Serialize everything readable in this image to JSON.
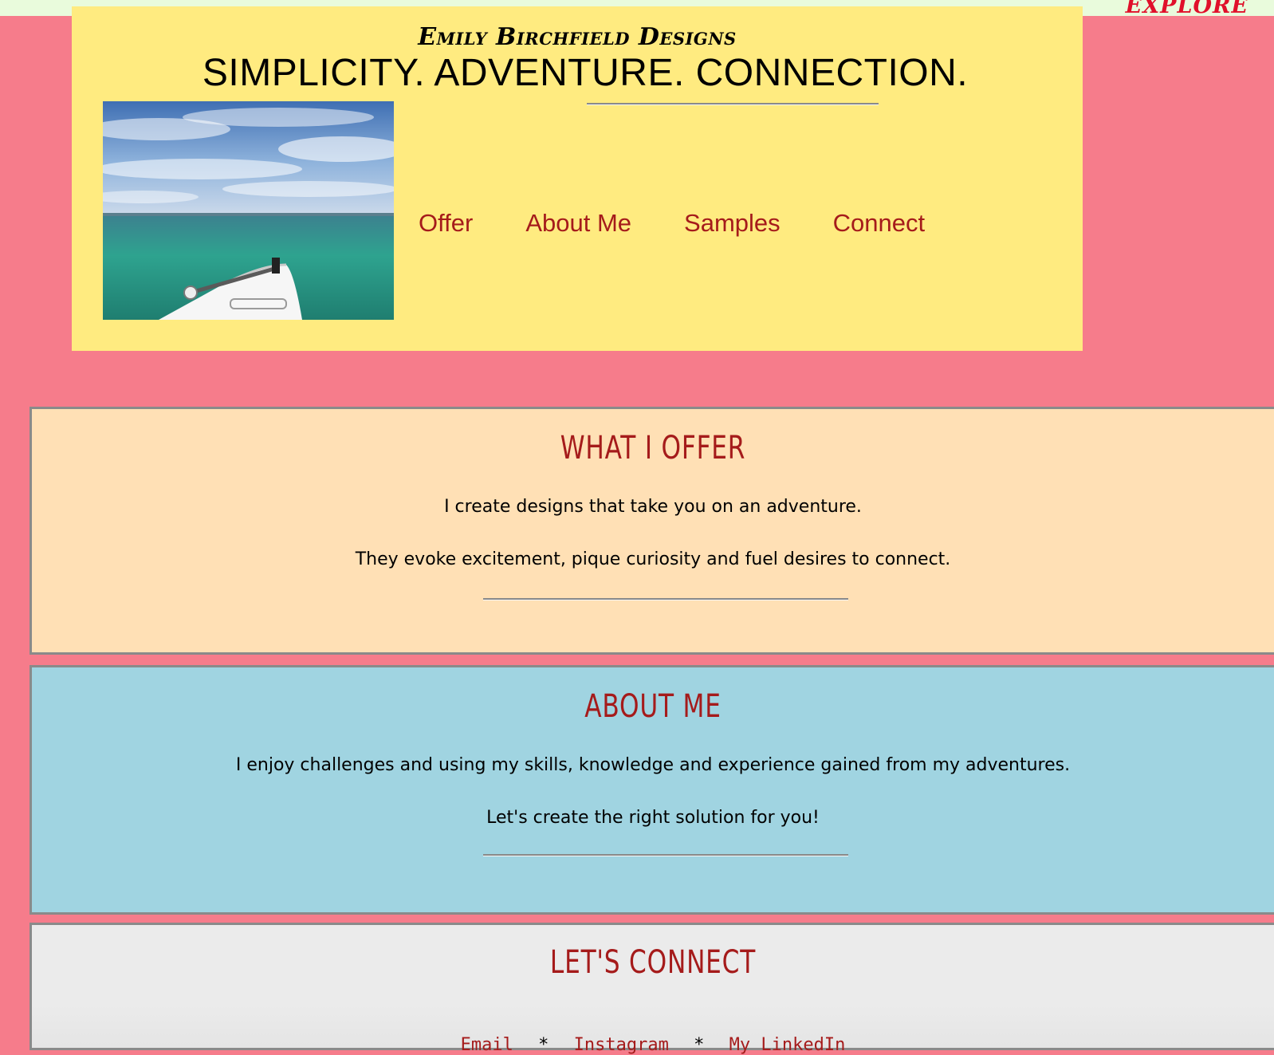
{
  "topbar": {
    "explore_label": "Explore"
  },
  "header": {
    "brand": "Emily Birchfield Designs",
    "tagline": "SIMPLICITY. ADVENTURE. CONNECTION.",
    "hero_image_alt": "Ocean view from boat bow",
    "nav": [
      {
        "label": "Offer"
      },
      {
        "label": "About Me"
      },
      {
        "label": "Samples"
      },
      {
        "label": "Connect"
      }
    ]
  },
  "offer": {
    "heading": "WHAT I OFFER",
    "lines": [
      "I create designs that take you on an adventure.",
      "They evoke excitement, pique curiosity and fuel desires to connect."
    ]
  },
  "about": {
    "heading": "ABOUT ME",
    "lines": [
      "I enjoy challenges and using my skills, knowledge and experience gained from my adventures.",
      "Let's create the right solution for you!"
    ]
  },
  "connect": {
    "heading": "LET'S CONNECT",
    "links": [
      {
        "label": "Email"
      },
      {
        "label": "Instagram"
      },
      {
        "label": "My LinkedIn"
      }
    ],
    "separator": "*"
  },
  "colors": {
    "page_bg": "#f67c8b",
    "header_bg": "#ffeb80",
    "offer_bg": "#ffe0b5",
    "about_bg": "#a0d4e1",
    "connect_bg": "#ebebeb",
    "accent": "#a51b1b",
    "explore": "#e0102a"
  }
}
